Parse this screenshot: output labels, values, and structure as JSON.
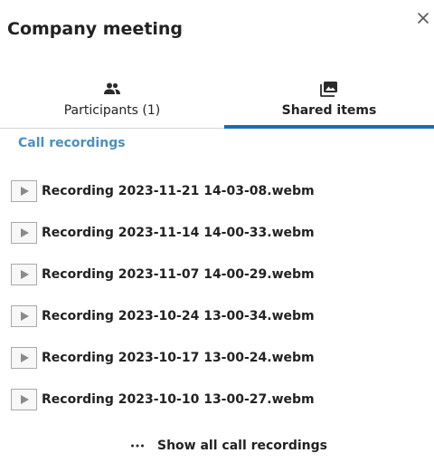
{
  "dialog": {
    "title": "Company meeting",
    "close_icon": "close-icon"
  },
  "tabs": [
    {
      "label": "Participants (1)",
      "icon": "participants-icon",
      "active": false
    },
    {
      "label": "Shared items",
      "icon": "shared-items-icon",
      "active": true
    }
  ],
  "section": {
    "heading": "Call recordings"
  },
  "recordings": [
    {
      "name": "Recording 2023-11-21 14-03-08.webm"
    },
    {
      "name": "Recording 2023-11-14 14-00-33.webm"
    },
    {
      "name": "Recording 2023-11-07 14-00-29.webm"
    },
    {
      "name": "Recording 2023-10-24 13-00-34.webm"
    },
    {
      "name": "Recording 2023-10-17 13-00-24.webm"
    },
    {
      "name": "Recording 2023-10-10 13-00-27.webm"
    }
  ],
  "show_all": {
    "label": "Show all call recordings",
    "icon": "more-icon"
  },
  "colors": {
    "accent": "#1a6dab",
    "section_heading": "#4a8fc2",
    "text": "#222222"
  }
}
